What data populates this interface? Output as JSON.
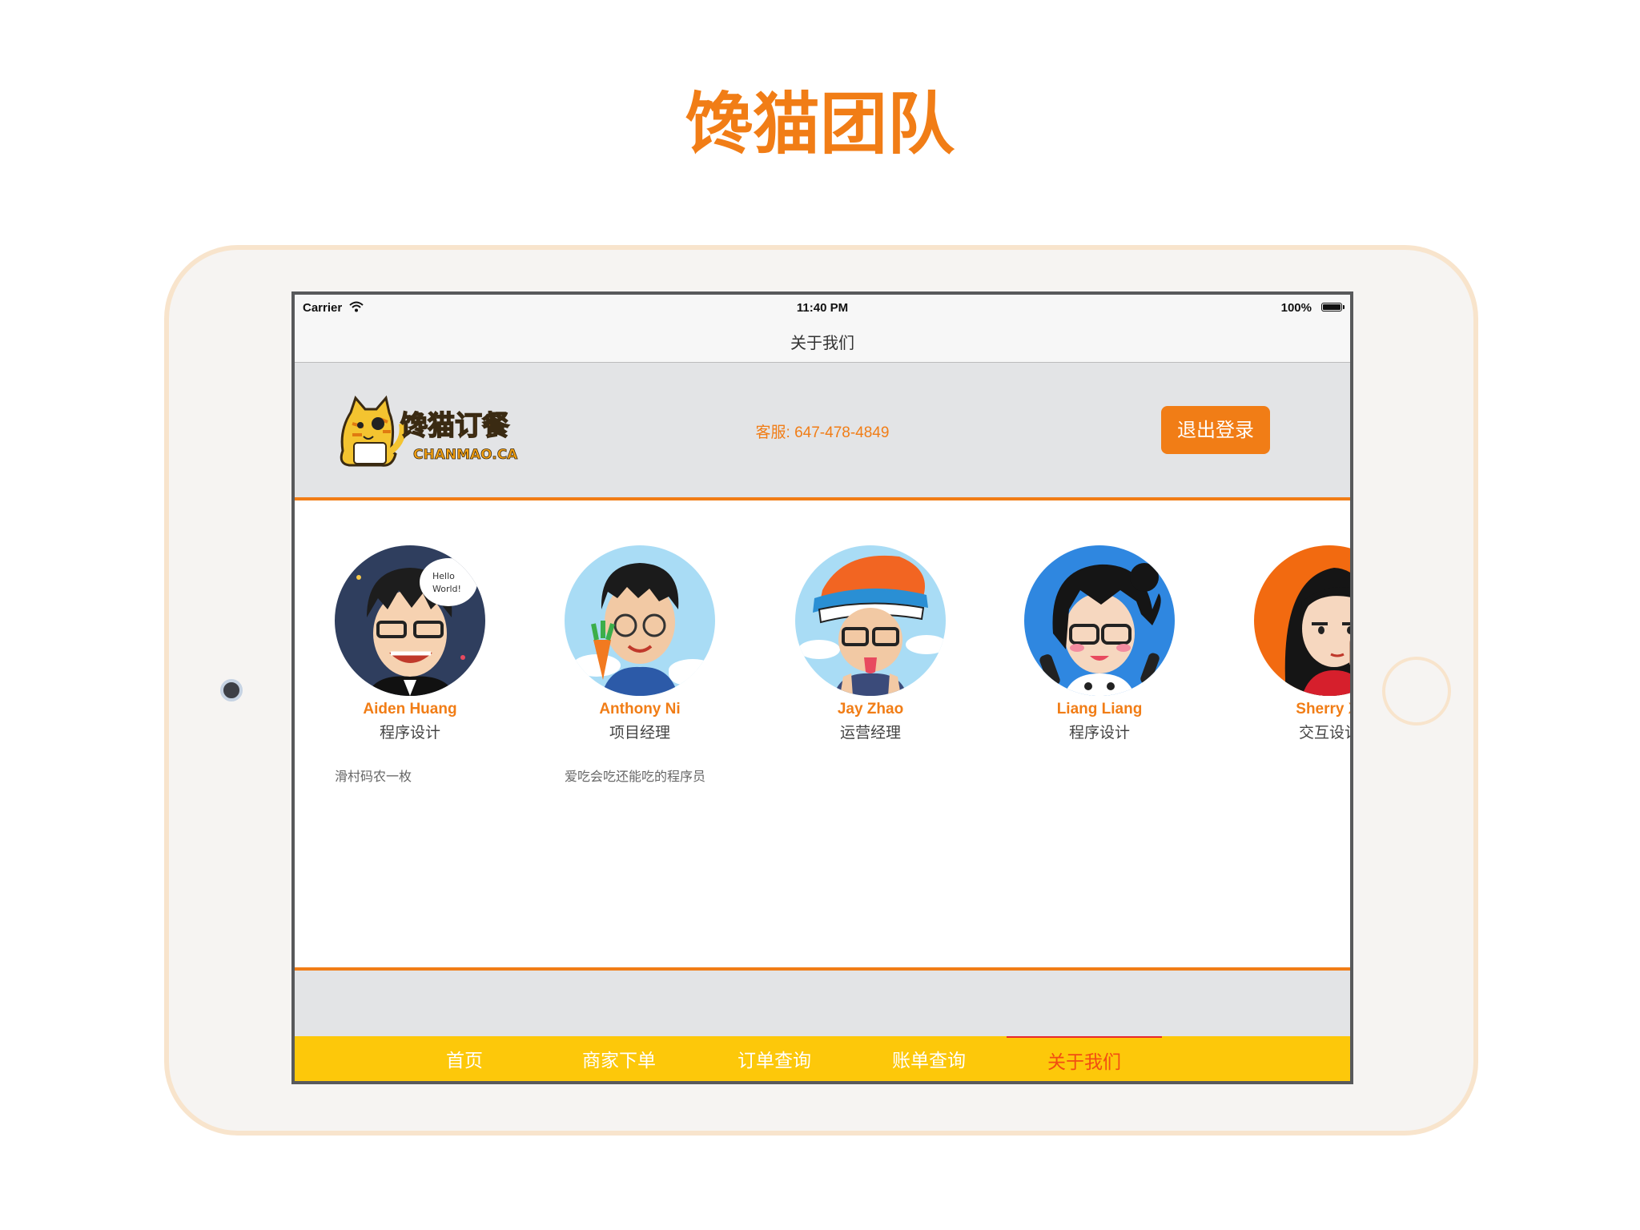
{
  "page_title": "馋猫团队",
  "status_bar": {
    "carrier": "Carrier",
    "time": "11:40 PM",
    "battery": "100%"
  },
  "nav": {
    "title": "关于我们"
  },
  "header": {
    "logo_text": "馋猫订餐",
    "logo_subtext": "CHANMAO.CA",
    "service_phone": "客服: 647-478-4849",
    "logout_label": "退出登录"
  },
  "team": [
    {
      "name": "Aiden Huang",
      "role": "程序设计",
      "bio": "滑村码农一枚",
      "speech": [
        "Hello",
        "World!"
      ]
    },
    {
      "name": "Anthony Ni",
      "role": "项目经理",
      "bio": "爱吃会吃还能吃的程序员"
    },
    {
      "name": "Jay Zhao",
      "role": "运营经理",
      "bio": ""
    },
    {
      "name": "Liang Liang",
      "role": "程序设计",
      "bio": ""
    },
    {
      "name": "Sherry Xi",
      "role": "交互设计",
      "bio": ""
    }
  ],
  "tabs": [
    {
      "label": "首页",
      "active": false
    },
    {
      "label": "商家下单",
      "active": false
    },
    {
      "label": "订单查询",
      "active": false
    },
    {
      "label": "账单查询",
      "active": false
    },
    {
      "label": "关于我们",
      "active": true
    }
  ],
  "colors": {
    "accent": "#f17d16",
    "tab_bar": "#fdc80a",
    "active_tab": "#f24d12",
    "header_bg": "#e3e4e6"
  }
}
